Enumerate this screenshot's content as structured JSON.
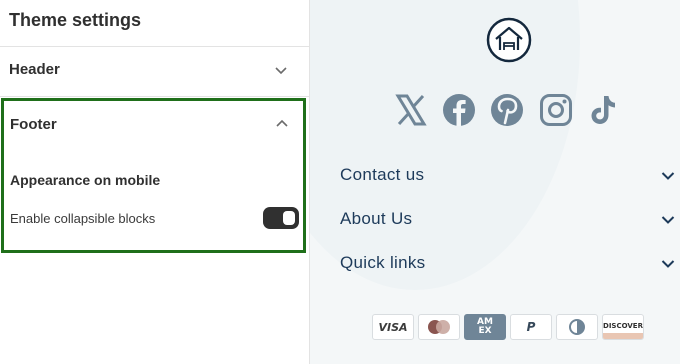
{
  "panel": {
    "title": "Theme settings",
    "sections": [
      {
        "label": "Header",
        "expanded": false
      },
      {
        "label": "Footer",
        "expanded": true
      }
    ],
    "footer": {
      "subtitle": "Appearance on mobile",
      "toggle_label": "Enable collapsible blocks",
      "toggle_on": true
    }
  },
  "preview": {
    "logo_icon": "home-icon",
    "socials": [
      "x-icon",
      "facebook-icon",
      "pinterest-icon",
      "instagram-icon",
      "tiktok-icon"
    ],
    "links": [
      "Contact us",
      "About Us",
      "Quick links"
    ],
    "payments": [
      {
        "name": "visa-icon",
        "text": "VISA"
      },
      {
        "name": "mastercard-icon",
        "text": ""
      },
      {
        "name": "amex-icon",
        "text": "AM EX"
      },
      {
        "name": "paypal-icon",
        "text": "P"
      },
      {
        "name": "diners-icon",
        "text": ""
      },
      {
        "name": "discover-icon",
        "text": "DISCOVER"
      }
    ],
    "colors": {
      "icon": "#6f8597",
      "link": "#1d3a5a",
      "accent_border": "#1f6f1a"
    }
  }
}
